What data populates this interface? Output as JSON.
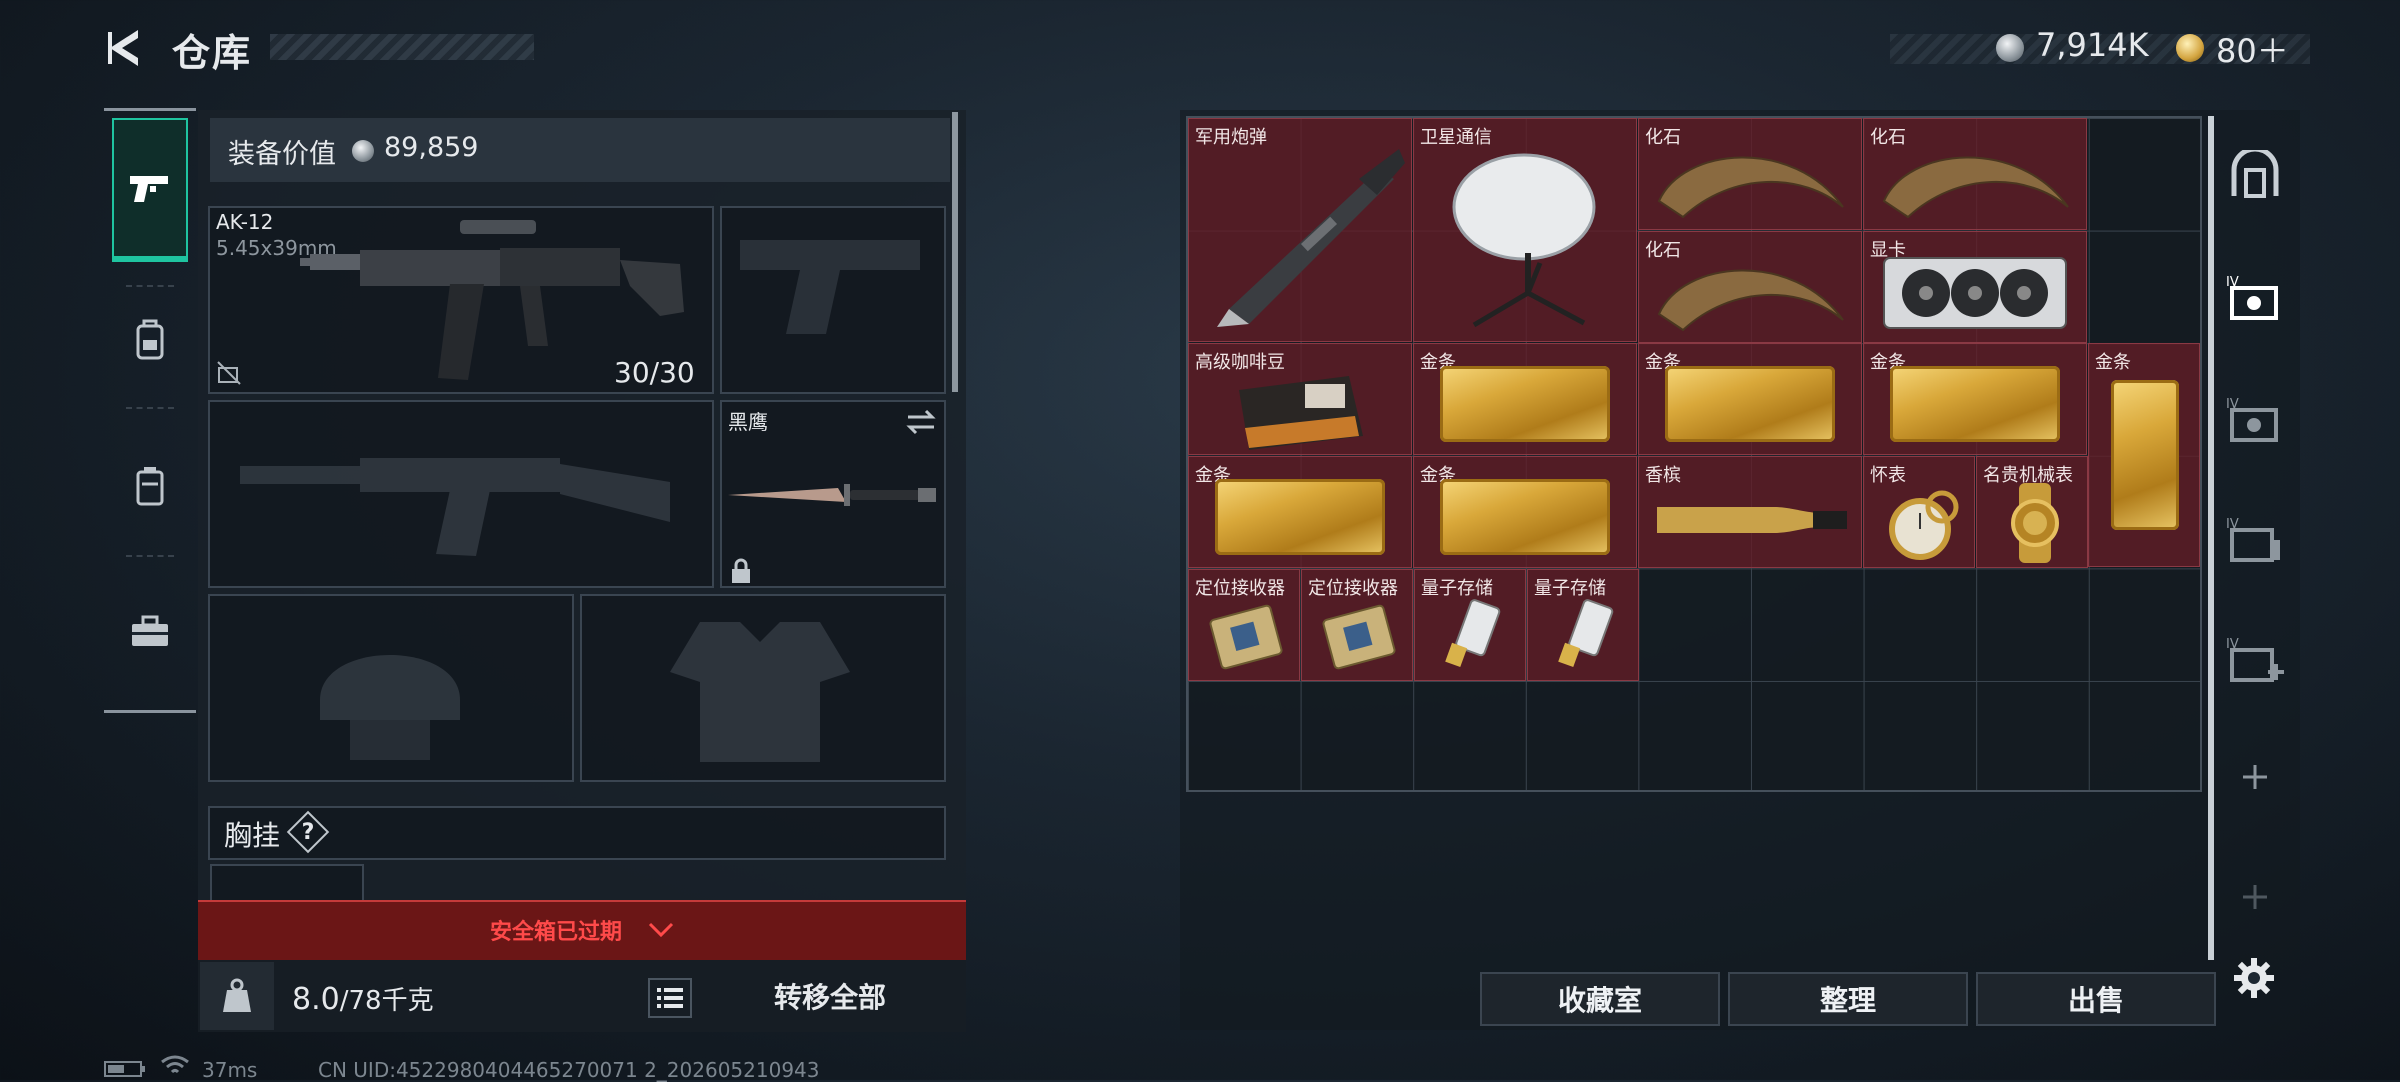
{
  "header": {
    "title": "仓库",
    "currency1": "7,914K",
    "currency2": "80＋"
  },
  "loadout": {
    "value_label": "装备价值",
    "value": "89,859",
    "primary": {
      "name": "AK-12",
      "caliber": "5.45x39mm",
      "ammo": "30/30"
    },
    "melee": {
      "name": "黑鹰"
    },
    "chest_rig": {
      "label": "胸挂",
      "help": "?"
    },
    "alert": "安全箱已过期",
    "weight": "8.0",
    "weight_max": "/78千克",
    "transfer_all": "转移全部"
  },
  "storage": {
    "items": [
      {
        "label": "军用炮弹"
      },
      {
        "label": "卫星通信"
      },
      {
        "label": "化石"
      },
      {
        "label": "化石"
      },
      {
        "label": "化石"
      },
      {
        "label": "显卡"
      },
      {
        "label": "高级咖啡豆"
      },
      {
        "label": "金条"
      },
      {
        "label": "金条"
      },
      {
        "label": "金条"
      },
      {
        "label": "金条"
      },
      {
        "label": "金条"
      },
      {
        "label": "金条"
      },
      {
        "label": "香槟"
      },
      {
        "label": "怀表"
      },
      {
        "label": "名贵机械表"
      },
      {
        "label": "定位接收器"
      },
      {
        "label": "定位接收器"
      },
      {
        "label": "量子存储"
      },
      {
        "label": "量子存储"
      }
    ]
  },
  "buttons": {
    "collection": "收藏室",
    "sort": "整理",
    "sell": "出售"
  },
  "status": {
    "ping": "37ms",
    "uid": "CN UID:4522980404465270071 2_202605210943"
  },
  "colors": {
    "accent": "#1fc4a0",
    "item_bg": "#641c26",
    "alert": "#ff4a4a"
  }
}
